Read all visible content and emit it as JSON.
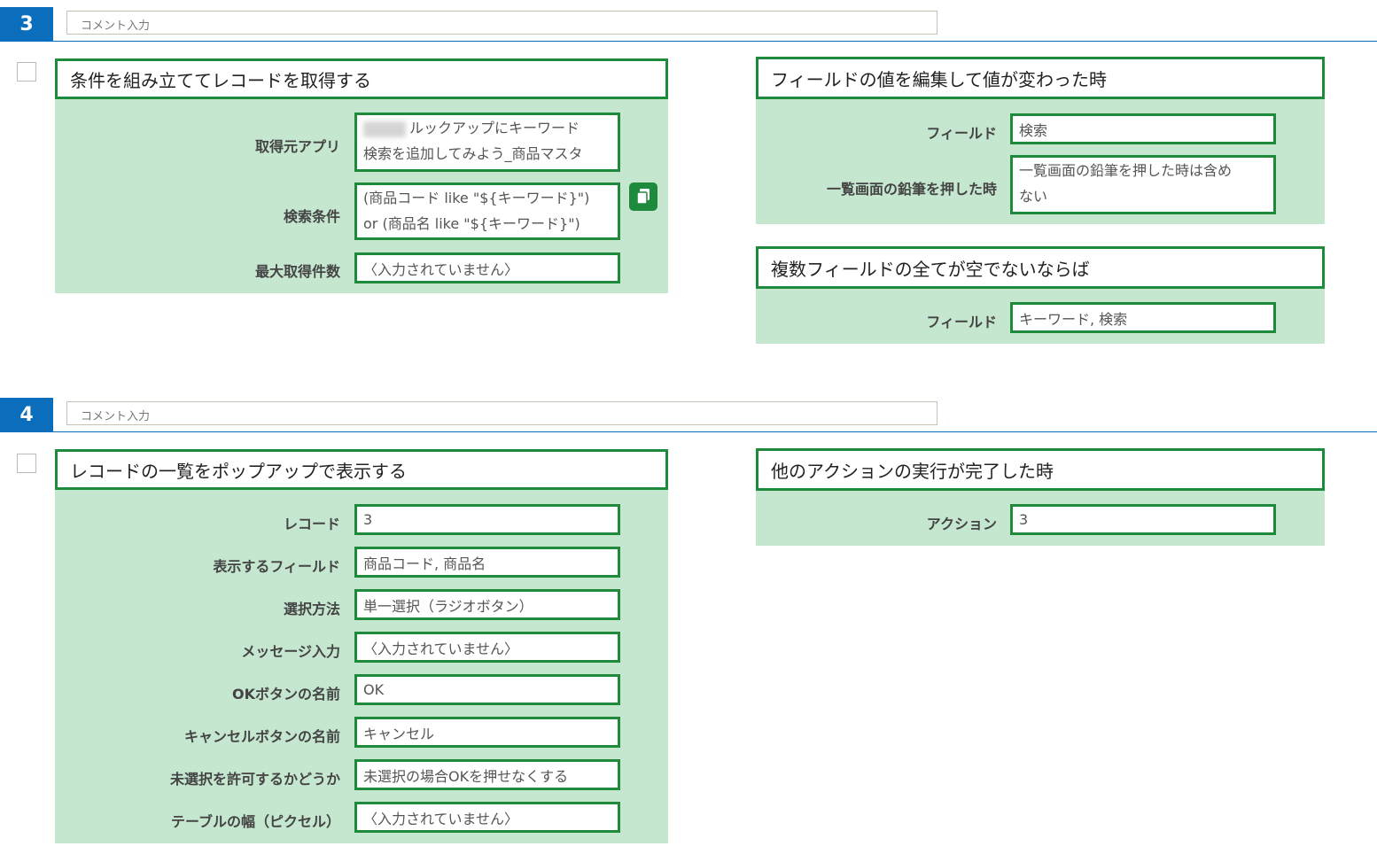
{
  "steps": [
    {
      "number": "3",
      "comment_placeholder": "コメント入力",
      "action": {
        "title": "条件を組み立ててレコードを取得する",
        "rows": [
          {
            "label": "取得元アプリ",
            "line1": "ルックアップにキーワード",
            "line2": "検索を追加してみよう_商品マスタ"
          },
          {
            "label": "検索条件",
            "line1": "(商品コード like \"${キーワード}\")",
            "line2": "or (商品名 like \"${キーワード}\")"
          },
          {
            "label": "最大取得件数",
            "value": "〈入力されていません〉"
          }
        ]
      },
      "triggers": [
        {
          "title": "フィールドの値を編集して値が変わった時",
          "rows": [
            {
              "label": "フィールド",
              "value": "検索"
            },
            {
              "label": "一覧画面の鉛筆を押した時",
              "line1": "一覧画面の鉛筆を押した時は含め",
              "line2": "ない"
            }
          ]
        },
        {
          "title": "複数フィールドの全てが空でないならば",
          "rows": [
            {
              "label": "フィールド",
              "value": "キーワード, 検索"
            }
          ]
        }
      ]
    },
    {
      "number": "4",
      "comment_placeholder": "コメント入力",
      "action": {
        "title": "レコードの一覧をポップアップで表示する",
        "rows": [
          {
            "label": "レコード",
            "value": "3"
          },
          {
            "label": "表示するフィールド",
            "value": "商品コード, 商品名"
          },
          {
            "label": "選択方法",
            "value": "単一選択（ラジオボタン）"
          },
          {
            "label": "メッセージ入力",
            "value": "〈入力されていません〉"
          },
          {
            "label": "OKボタンの名前",
            "value": "OK"
          },
          {
            "label": "キャンセルボタンの名前",
            "value": "キャンセル"
          },
          {
            "label": "未選択を許可するかどうか",
            "value": "未選択の場合OKを押せなくする"
          },
          {
            "label": "テーブルの幅（ピクセル）",
            "value": "〈入力されていません〉"
          }
        ]
      },
      "triggers": [
        {
          "title": "他のアクションの実行が完了した時",
          "rows": [
            {
              "label": "アクション",
              "value": "3"
            }
          ]
        }
      ]
    }
  ],
  "colors": {
    "step_badge": "#0a6ebd",
    "card_border": "#1e8a3c",
    "card_background": "#c5e6cf"
  },
  "icons": {
    "copy": "copy-icon"
  }
}
